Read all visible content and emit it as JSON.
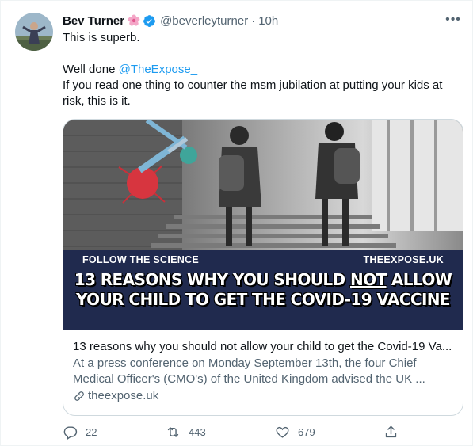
{
  "tweet": {
    "author_name": "Bev Turner",
    "author_handle": "@beverleyturner",
    "separator": "·",
    "time": "10h",
    "more_label": "•••",
    "text_line1": "This is superb.",
    "text_line2_prefix": "Well done ",
    "mention": "@TheExpose_",
    "text_line3": "If you read one thing to counter the msm jubilation at putting your kids at risk, this is it."
  },
  "card": {
    "banner_left": "FOLLOW THE SCIENCE",
    "banner_right": "THEEXPOSE.UK",
    "headline_part1": "13 REASONS WHY YOU SHOULD ",
    "headline_emph": "NOT",
    "headline_part2": " ALLOW",
    "headline_line2": "YOUR CHILD TO GET THE COVID-19 VACCINE",
    "title": "13 reasons why you should not allow your child to get the Covid-19 Va...",
    "description": "At a press conference on Monday September 13th, the four Chief Medical Officer's (CMO's) of the United Kingdom advised the UK ...",
    "domain": "theexpose.uk"
  },
  "actions": {
    "replies": "22",
    "retweets": "443",
    "likes": "679"
  },
  "colors": {
    "accent": "#1d9bf0",
    "muted": "#536471",
    "banner": "#202a4e"
  },
  "icons": [
    "flower-emoji-icon",
    "verified-badge-icon",
    "more-icon",
    "link-icon",
    "reply-icon",
    "retweet-icon",
    "like-icon",
    "share-icon"
  ]
}
